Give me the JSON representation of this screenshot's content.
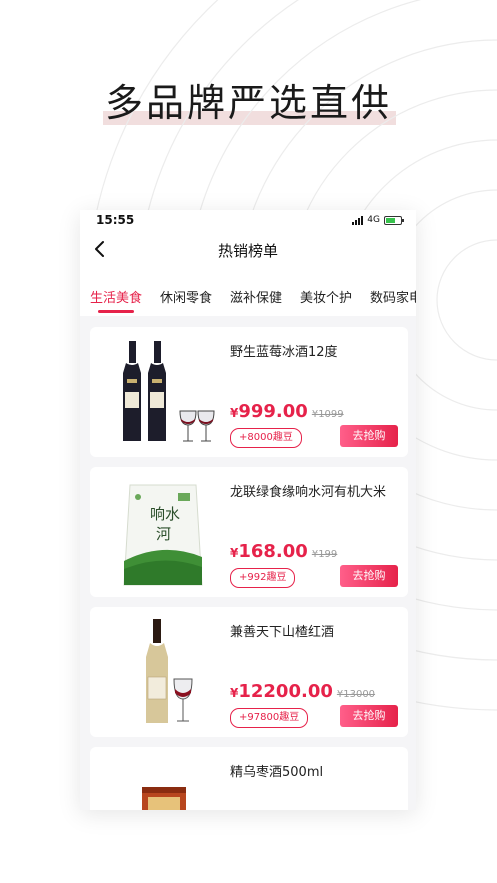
{
  "headline": "多品牌严选直供",
  "status_bar": {
    "time": "15:55",
    "network": "4G"
  },
  "nav": {
    "title": "热销榜单"
  },
  "tabs": [
    {
      "label": "生活美食",
      "active": true
    },
    {
      "label": "休闲零食",
      "active": false
    },
    {
      "label": "滋补保健",
      "active": false
    },
    {
      "label": "美妆个护",
      "active": false
    },
    {
      "label": "数码家电",
      "active": false
    }
  ],
  "products": [
    {
      "name": "野生蓝莓冰酒12度",
      "currency": "¥",
      "price": "999.00",
      "original": "¥1099",
      "points": "+8000趣豆",
      "button": "去抢购",
      "image": "wine-bottles-image"
    },
    {
      "name": "龙联绿食缘响水河有机大米",
      "currency": "¥",
      "price": "168.00",
      "original": "¥199",
      "points": "+992趣豆",
      "button": "去抢购",
      "image": "rice-bag-image"
    },
    {
      "name": "兼善天下山楂红酒",
      "currency": "¥",
      "price": "12200.00",
      "original": "¥13000",
      "points": "+97800趣豆",
      "button": "去抢购",
      "image": "hawthorn-wine-image"
    },
    {
      "name": "精乌枣酒500ml",
      "image": "jujube-wine-image"
    }
  ],
  "colors": {
    "accent": "#e6224a",
    "highlight_bar": "#f1dede",
    "page_bg": "#f5f5f7"
  }
}
